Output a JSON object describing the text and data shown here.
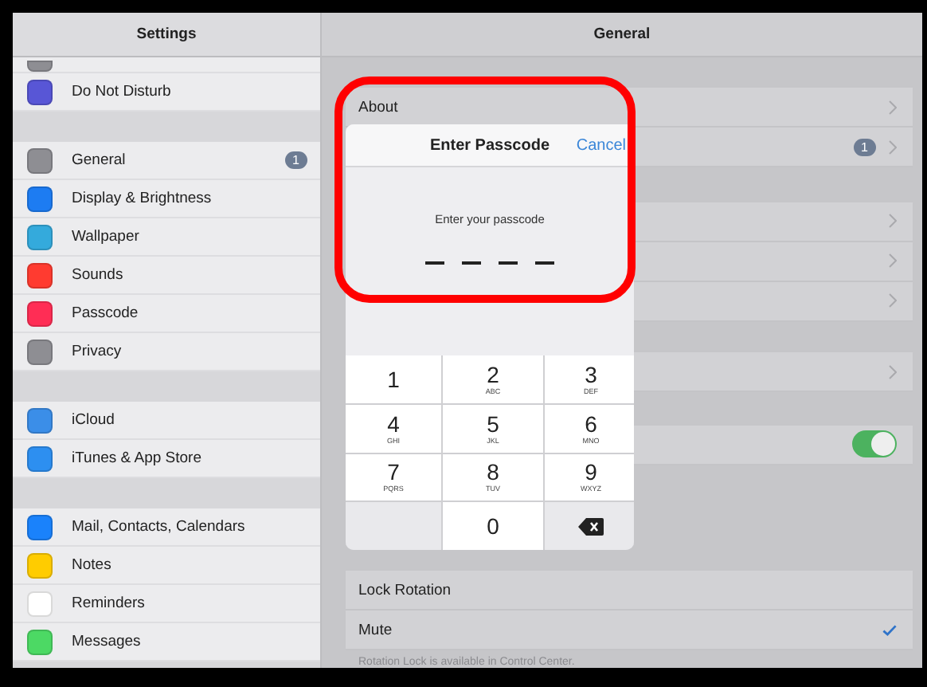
{
  "sidebar": {
    "title": "Settings",
    "groups": [
      {
        "items": [
          {
            "color": "#8e8e93"
          },
          {
            "label": "Do Not Disturb",
            "color": "#5856d6"
          }
        ]
      },
      {
        "items": [
          {
            "label": "General",
            "color": "#8e8e93",
            "badge": "1"
          },
          {
            "label": "Display & Brightness",
            "color": "#1d7cf2"
          },
          {
            "label": "Wallpaper",
            "color": "#34aadc"
          },
          {
            "label": "Sounds",
            "color": "#ff3b30"
          },
          {
            "label": "Passcode",
            "color": "#ff2d55"
          },
          {
            "label": "Privacy",
            "color": "#8e8e93"
          }
        ]
      },
      {
        "items": [
          {
            "label": "iCloud",
            "color": "#3b8ee8"
          },
          {
            "label": "iTunes & App Store",
            "color": "#2d8ff0"
          }
        ]
      },
      {
        "items": [
          {
            "label": "Mail, Contacts, Calendars",
            "color": "#1a82fb"
          },
          {
            "label": "Notes",
            "color": "#ffcc00"
          },
          {
            "label": "Reminders",
            "color": "#ffffff"
          },
          {
            "label": "Messages",
            "color": "#4cd964"
          }
        ]
      }
    ]
  },
  "detail": {
    "title": "General",
    "groups": [
      {
        "rows": [
          {
            "kind": "link",
            "label": "About"
          },
          {
            "kind": "link",
            "badge": "1"
          }
        ]
      },
      {
        "rows": [
          {
            "kind": "link"
          },
          {
            "kind": "link"
          },
          {
            "kind": "link"
          }
        ]
      },
      {
        "rows": [
          {
            "kind": "link"
          }
        ]
      },
      {
        "rows": [
          {
            "kind": "toggle",
            "on": true
          }
        ]
      },
      {
        "rows": [
          {
            "kind": "check",
            "label": "Lock Rotation",
            "selected": false
          },
          {
            "kind": "check",
            "label": "Mute",
            "selected": true
          }
        ],
        "footer": "Rotation Lock is available in Control Center."
      }
    ]
  },
  "passcode_dialog": {
    "title": "Enter Passcode",
    "cancel": "Cancel",
    "prompt": "Enter your passcode",
    "slots": [
      {
        "filled": false
      },
      {
        "filled": false
      },
      {
        "filled": false
      },
      {
        "filled": false
      }
    ],
    "keys": [
      {
        "kind": "digit",
        "digit": "1"
      },
      {
        "kind": "digit",
        "digit": "2",
        "letters": "ABC"
      },
      {
        "kind": "digit",
        "digit": "3",
        "letters": "DEF"
      },
      {
        "kind": "digit",
        "digit": "4",
        "letters": "GHI"
      },
      {
        "kind": "digit",
        "digit": "5",
        "letters": "JKL"
      },
      {
        "kind": "digit",
        "digit": "6",
        "letters": "MNO"
      },
      {
        "kind": "digit",
        "digit": "7",
        "letters": "PQRS"
      },
      {
        "kind": "digit",
        "digit": "8",
        "letters": "TUV"
      },
      {
        "kind": "digit",
        "digit": "9",
        "letters": "WXYZ"
      },
      {
        "kind": "blank"
      },
      {
        "kind": "digit",
        "digit": "0"
      },
      {
        "kind": "delete"
      }
    ]
  }
}
